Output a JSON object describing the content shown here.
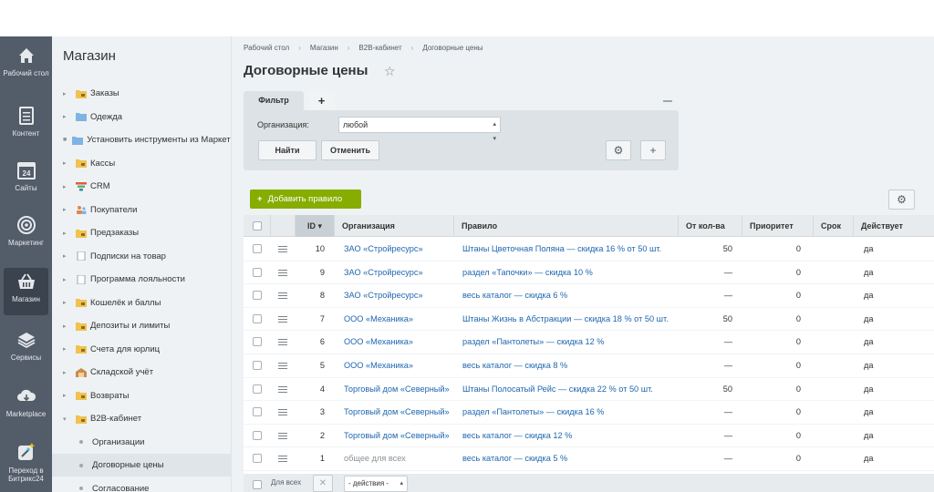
{
  "leftbar": {
    "items": [
      {
        "label": "Рабочий стол",
        "icon": "home-icon"
      },
      {
        "label": "Контент",
        "icon": "document-icon"
      },
      {
        "label": "Сайты",
        "icon": "calendar-24-icon"
      },
      {
        "label": "Маркетинг",
        "icon": "target-icon"
      },
      {
        "label": "Магазин",
        "icon": "basket-icon"
      },
      {
        "label": "Сервисы",
        "icon": "layers-icon"
      },
      {
        "label": "Marketplace",
        "icon": "cloud-download-icon"
      },
      {
        "label": "Переход в Битрикс24",
        "icon": "magic-wand-icon"
      }
    ]
  },
  "menu": {
    "title": "Магазин",
    "items": [
      {
        "label": "Заказы",
        "icon": "folder-lock-icon",
        "kind": "folder"
      },
      {
        "label": "Одежда",
        "icon": "folder-icon",
        "kind": "folder"
      },
      {
        "label": "Установить инструменты из Маркетплейс",
        "icon": "folder-icon",
        "kind": "leaf-folder"
      },
      {
        "label": "Кассы",
        "icon": "folder-lock-icon",
        "kind": "folder"
      },
      {
        "label": "CRM",
        "icon": "funnel-icon",
        "kind": "folder"
      },
      {
        "label": "Покупатели",
        "icon": "users-icon",
        "kind": "folder"
      },
      {
        "label": "Предзаказы",
        "icon": "folder-lock-icon",
        "kind": "folder"
      },
      {
        "label": "Подписки на товар",
        "icon": "page-icon",
        "kind": "folder"
      },
      {
        "label": "Программа лояльности",
        "icon": "page-icon",
        "kind": "folder"
      },
      {
        "label": "Кошелёк и баллы",
        "icon": "folder-lock-icon",
        "kind": "folder"
      },
      {
        "label": "Депозиты и лимиты",
        "icon": "folder-lock-icon",
        "kind": "folder"
      },
      {
        "label": "Счета для юрлиц",
        "icon": "folder-lock-icon",
        "kind": "folder"
      },
      {
        "label": "Складской учёт",
        "icon": "warehouse-icon",
        "kind": "folder"
      },
      {
        "label": "Возвраты",
        "icon": "folder-lock-icon",
        "kind": "folder"
      },
      {
        "label": "B2B-кабинет",
        "icon": "folder-lock-icon",
        "kind": "open"
      },
      {
        "label": "Организации",
        "kind": "sub"
      },
      {
        "label": "Договорные цены",
        "kind": "sub",
        "selected": true
      },
      {
        "label": "Согласование",
        "kind": "sub"
      }
    ]
  },
  "breadcrumb": [
    "Рабочий стол",
    "Магазин",
    "B2B-кабинет",
    "Договорные цены"
  ],
  "page_title": "Договорные цены",
  "filter": {
    "tab_label": "Фильтр",
    "add_tab": "+",
    "org_label": "Организация:",
    "org_value": "любой",
    "find_label": "Найти",
    "cancel_label": "Отменить"
  },
  "add_rule_label": "Добавить правило",
  "grid": {
    "columns": [
      "ID",
      "Организация",
      "Правило",
      "От кол-ва",
      "Приоритет",
      "Срок",
      "Действует"
    ],
    "rows": [
      {
        "id": "10",
        "org": "ЗАО «Стройресурс»",
        "rule": "Штаны Цветочная Поляна — скидка 16 % от 50 шт.",
        "qty": "50",
        "priority": "0",
        "term": "",
        "active": "да"
      },
      {
        "id": "9",
        "org": "ЗАО «Стройресурс»",
        "rule": "раздел «Тапочки» — скидка 10 %",
        "qty": "—",
        "priority": "0",
        "term": "",
        "active": "да"
      },
      {
        "id": "8",
        "org": "ЗАО «Стройресурс»",
        "rule": "весь каталог — скидка 6 %",
        "qty": "—",
        "priority": "0",
        "term": "",
        "active": "да"
      },
      {
        "id": "7",
        "org": "ООО «Механика»",
        "rule": "Штаны Жизнь в Абстракции — скидка 18 % от 50 шт.",
        "qty": "50",
        "priority": "0",
        "term": "",
        "active": "да"
      },
      {
        "id": "6",
        "org": "ООО «Механика»",
        "rule": "раздел «Пантолеты» — скидка 12 %",
        "qty": "—",
        "priority": "0",
        "term": "",
        "active": "да"
      },
      {
        "id": "5",
        "org": "ООО «Механика»",
        "rule": "весь каталог — скидка 8 %",
        "qty": "—",
        "priority": "0",
        "term": "",
        "active": "да"
      },
      {
        "id": "4",
        "org": "Торговый дом «Северный»",
        "rule": "Штаны Полосатый Рейс — скидка 22 % от 50 шт.",
        "qty": "50",
        "priority": "0",
        "term": "",
        "active": "да"
      },
      {
        "id": "3",
        "org": "Торговый дом «Северный»",
        "rule": "раздел «Пантолеты» — скидка 16 %",
        "qty": "—",
        "priority": "0",
        "term": "",
        "active": "да"
      },
      {
        "id": "2",
        "org": "Торговый дом «Северный»",
        "rule": "весь каталог — скидка 12 %",
        "qty": "—",
        "priority": "0",
        "term": "",
        "active": "да"
      },
      {
        "id": "1",
        "org": "общее для всех",
        "org_link": false,
        "rule": "весь каталог — скидка 5 %",
        "qty": "—",
        "priority": "0",
        "term": "",
        "active": "да"
      }
    ]
  },
  "footer": {
    "all_label": "Для всех",
    "actions_label": "- действия -"
  },
  "colors": {
    "sidebar": "#535c69",
    "accent_green": "#86ad00",
    "link": "#2067b0"
  }
}
